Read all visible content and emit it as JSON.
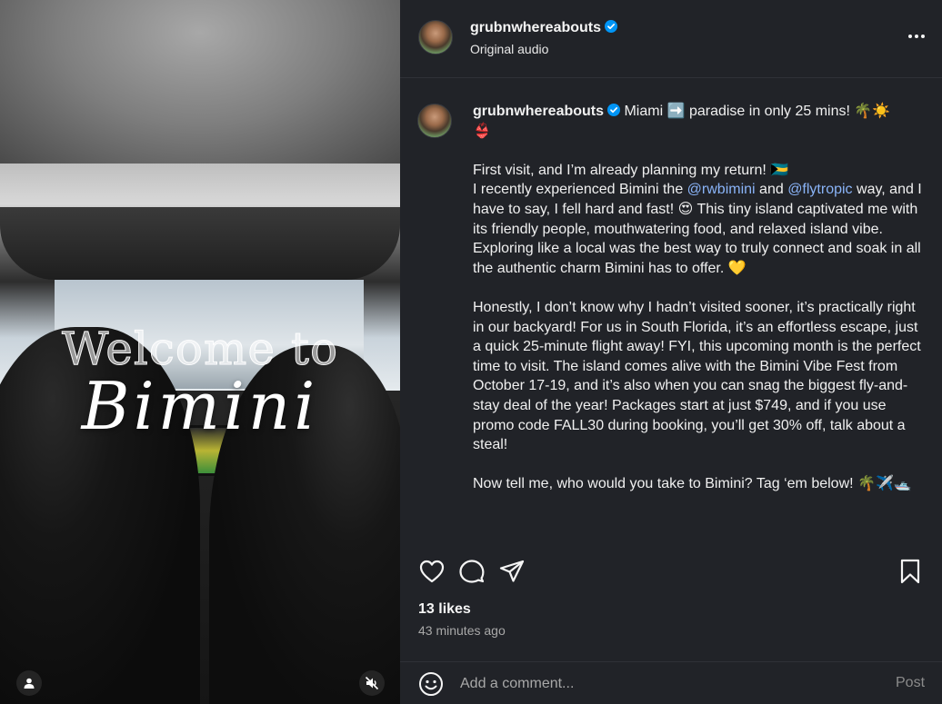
{
  "media": {
    "overlay_line1": "Welcome to",
    "overlay_line2": "Bimini"
  },
  "header": {
    "username": "grubnwhereabouts",
    "audio": "Original audio"
  },
  "caption": {
    "username": "grubnwhereabouts",
    "first_line": " Miami ➡️ paradise in only 25 mins! 🌴☀️",
    "line_after": "👙",
    "p1": {
      "a": "First visit, and I’m already planning my return! 🇧🇸",
      "b": "I recently experienced Bimini the ",
      "mention1": "@rwbimini",
      "c": " and ",
      "mention2": "@flytropic",
      "d": " way, and I have to say, I fell hard and fast! 😍 This tiny island captivated me with its friendly people, mouthwatering food, and relaxed island vibe. Exploring like a local was the best way to truly connect and soak in all the authentic charm Bimini has to offer. 💛"
    },
    "p2": "Honestly, I don’t know why I hadn’t visited sooner, it’s practically right in our backyard! For us in South Florida, it’s an effortless escape, just a quick 25-minute flight away! FYI, this upcoming month is the perfect time to visit. The island comes alive with the Bimini Vibe Fest from October 17-19, and it’s also when you can snag the biggest fly-and-stay deal of the year! Packages start at just $749, and if you use promo code FALL30 during booking, you’ll get 30% off, talk about a steal!",
    "p3": "Now tell me, who would you take to Bimini? Tag ‘em below! 🌴✈️🛥️"
  },
  "stats": {
    "likes": "13 likes",
    "time": "43 minutes ago"
  },
  "comment": {
    "placeholder": "Add a comment...",
    "post_label": "Post"
  },
  "icons": {
    "verified": "verified-badge-icon",
    "more": "more-options-icon",
    "like": "heart-icon",
    "comment": "comment-bubble-icon",
    "share": "send-icon",
    "save": "bookmark-icon",
    "emoji": "emoji-smile-icon",
    "user": "user-tag-icon",
    "mute": "muted-speaker-icon"
  },
  "colors": {
    "panel_bg": "#212328",
    "mention": "#8ab4f8",
    "verified": "#0095f6",
    "secondary_text": "#a8a8a8"
  }
}
